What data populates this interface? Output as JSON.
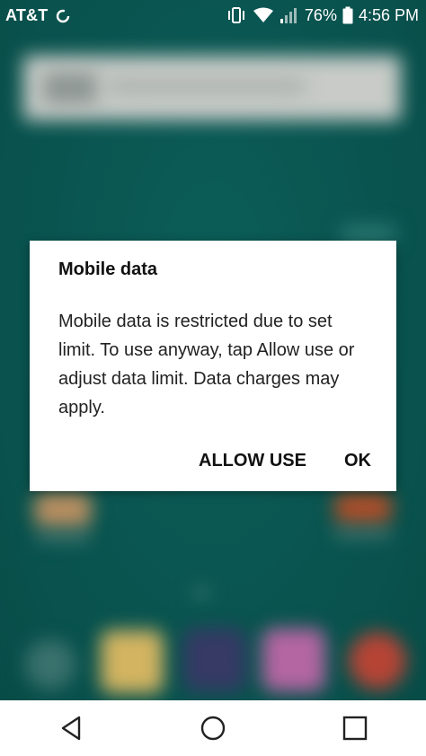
{
  "status_bar": {
    "carrier": "AT&T",
    "battery_percent": "76%",
    "time": "4:56 PM",
    "icons": [
      "sync-icon",
      "vibrate-icon",
      "wifi-icon",
      "signal-icon",
      "battery-icon"
    ]
  },
  "dialog": {
    "title": "Mobile data",
    "message": "Mobile data is restricted due to set limit. To use anyway, tap Allow use or adjust data limit. Data charges may apply.",
    "allow_label": "ALLOW USE",
    "ok_label": "OK"
  },
  "nav_bar": {
    "icons": [
      "back-icon",
      "home-icon",
      "recents-icon"
    ]
  },
  "colors": {
    "background": "#0a5b56",
    "dialog": "#ffffff",
    "text": "#111111"
  }
}
